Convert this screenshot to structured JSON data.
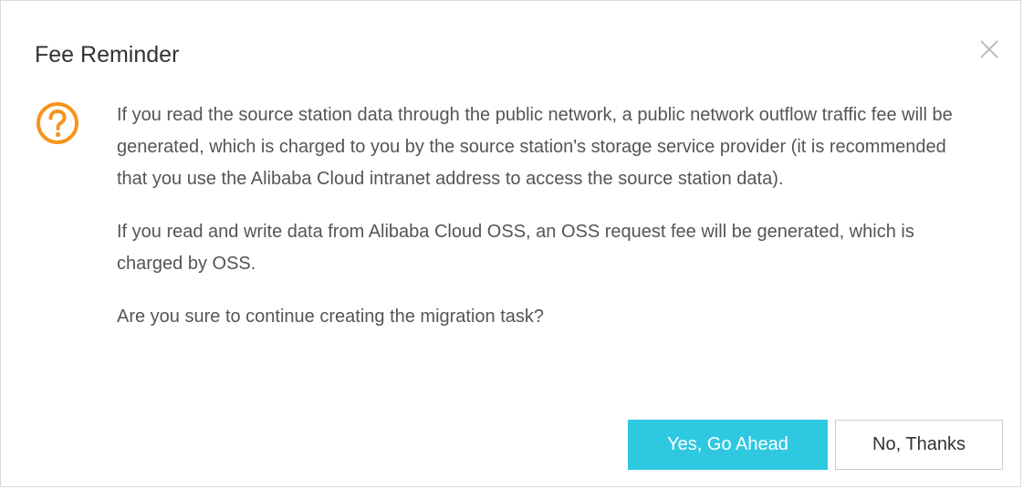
{
  "dialog": {
    "title": "Fee Reminder",
    "close_icon": "close-icon",
    "question_icon": "question-circle-icon",
    "icon_color": "#f7941d",
    "paragraphs": [
      "If you read the source station data through the public network, a public network outflow traffic fee will be generated, which is charged to you by the source station's storage service provider (it is recommended that you use the Alibaba Cloud intranet address to access the source station data).",
      "If you read and write data from Alibaba Cloud OSS, an OSS request fee will be generated, which is charged by OSS.",
      "Are you sure to continue creating the migration task?"
    ],
    "confirm_label": "Yes, Go Ahead",
    "cancel_label": "No, Thanks",
    "accent_color": "#2fc8e1"
  }
}
